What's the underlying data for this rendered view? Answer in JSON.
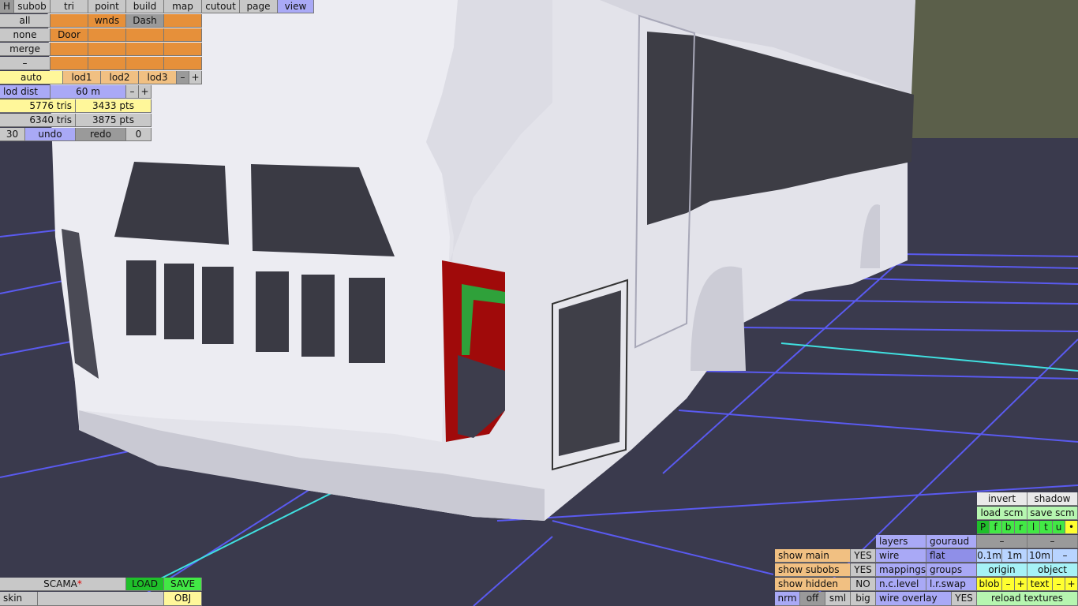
{
  "top_menu": [
    "H",
    "subob",
    "tri",
    "point",
    "build",
    "map",
    "cutout",
    "page",
    "view"
  ],
  "subob": {
    "all": "all",
    "wnds": "wnds",
    "dash": "Dash",
    "none": "none",
    "door": "Door",
    "merge": "merge",
    "minus": "–"
  },
  "lod": {
    "auto": "auto",
    "lod1": "lod1",
    "lod2": "lod2",
    "lod3": "lod3",
    "minus": "–",
    "plus": "+",
    "dist_label": "lod dist",
    "dist_value": "60 m"
  },
  "stats": {
    "tris1": "5776 tris",
    "pts1": "3433 pts",
    "tris2": "6340 tris",
    "pts2": "3875 pts"
  },
  "history": {
    "count": "30",
    "undo": "undo",
    "redo": "redo",
    "redo_count": "0"
  },
  "file": {
    "name": "SCAMA",
    "dirty_mark": "*",
    "load": "LOAD",
    "save": "SAVE",
    "skin": "skin",
    "obj": "OBJ"
  },
  "right_panel": {
    "invert": "invert",
    "shadow": "shadow",
    "load_scm": "load scm",
    "save_scm": "save scm",
    "flags": [
      "P",
      "f",
      "b",
      "r",
      "l",
      "t",
      "u",
      "•"
    ],
    "minus": "–",
    "plus": "+",
    "steps": [
      "0.1m",
      "1m",
      "10m"
    ],
    "origin": "origin",
    "object": "object",
    "blob": "blob",
    "text": "text",
    "reload": "reload textures"
  },
  "render": {
    "layers": "layers",
    "gouraud": "gouraud",
    "wire": "wire",
    "flat": "flat",
    "mappings": "mappings",
    "groups": "groups",
    "nc_level": "n.c.level",
    "lr_swap": "l.r.swap",
    "wire_overlay": "wire overlay",
    "wire_overlay_val": "YES"
  },
  "show": {
    "main": "show main",
    "main_val": "YES",
    "subobs": "show subobs",
    "subobs_val": "YES",
    "hidden": "show hidden",
    "hidden_val": "NO",
    "nrm": "nrm",
    "off": "off",
    "sml": "sml",
    "big": "big"
  }
}
